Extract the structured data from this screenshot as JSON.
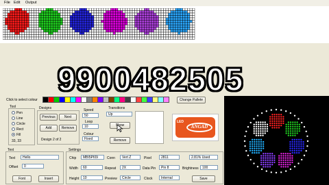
{
  "menu": [
    "File",
    "Edit",
    "Output"
  ],
  "overlay_number": "9900482505",
  "palette": {
    "label": "Click to select colour",
    "colors": [
      "#000000",
      "#ff0000",
      "#00cc00",
      "#0000ff",
      "#ffff00",
      "#00ffff",
      "#ff00ff",
      "#ffffff",
      "#808080",
      "#ff8000",
      "#8000ff",
      "#c0c0c0",
      "#804000",
      "#00ff80",
      "#ff0080",
      "#404040",
      "#ffffff",
      "#ff4040",
      "#40ff40",
      "#4040ff",
      "#ffff80",
      "#80ffff",
      "#ff80ff"
    ],
    "change_palette": "Change Pallete"
  },
  "led_colors": [
    "#ff1a1a",
    "#1fd11f",
    "#2424e0",
    "#e000e0",
    "#b040e0",
    "#2aa8ff"
  ],
  "tool": {
    "label": "Tool",
    "options": [
      "Pen",
      "Line",
      "Circle",
      "Rect",
      "Fill"
    ],
    "selected": "Fill",
    "coords": "33, 33"
  },
  "designs": {
    "label": "Designs",
    "previous": "Previous",
    "next": "Next",
    "add": "Add",
    "remove": "Remove",
    "status": "Design 2 of 2"
  },
  "speed": {
    "label": "Speed",
    "value": "50"
  },
  "loop": {
    "label": "Loop",
    "value": "10"
  },
  "colour": {
    "label": "Colour",
    "value": "Fixed"
  },
  "transitions": {
    "label": "Transitions",
    "value": "Up",
    "show": "Show",
    "remove": "Remove"
  },
  "text_section": {
    "label": "Text",
    "text_label": "Text",
    "text_value": "Hello",
    "offset_label": "Offset",
    "offset_value": "0",
    "font": "Font",
    "insert": "Insert"
  },
  "settings": {
    "label": "Settings",
    "chip_label": "Chip",
    "chip_value": "MBI5PI09",
    "conn_label": "Conn",
    "conn_value": "Vert Z",
    "pixel_label": "Pixel",
    "pixel_value": "2811",
    "used": "2.81% Used",
    "width_label": "Width",
    "width_value": "60",
    "repeat_label": "Repeat",
    "repeat_value": "2X",
    "data_pin_label": "Data Pin",
    "data_pin_value": "Pin 8",
    "brightness_label": "Brightness",
    "brightness_value": "100",
    "height_label": "Height",
    "height_value": "10",
    "preview_label": "Preview",
    "preview_value": "Circle",
    "clock_label": "Clock",
    "clock_value": "Internal",
    "save": "Save"
  },
  "logo": {
    "text": "ANGAD",
    "sub": "LED"
  }
}
